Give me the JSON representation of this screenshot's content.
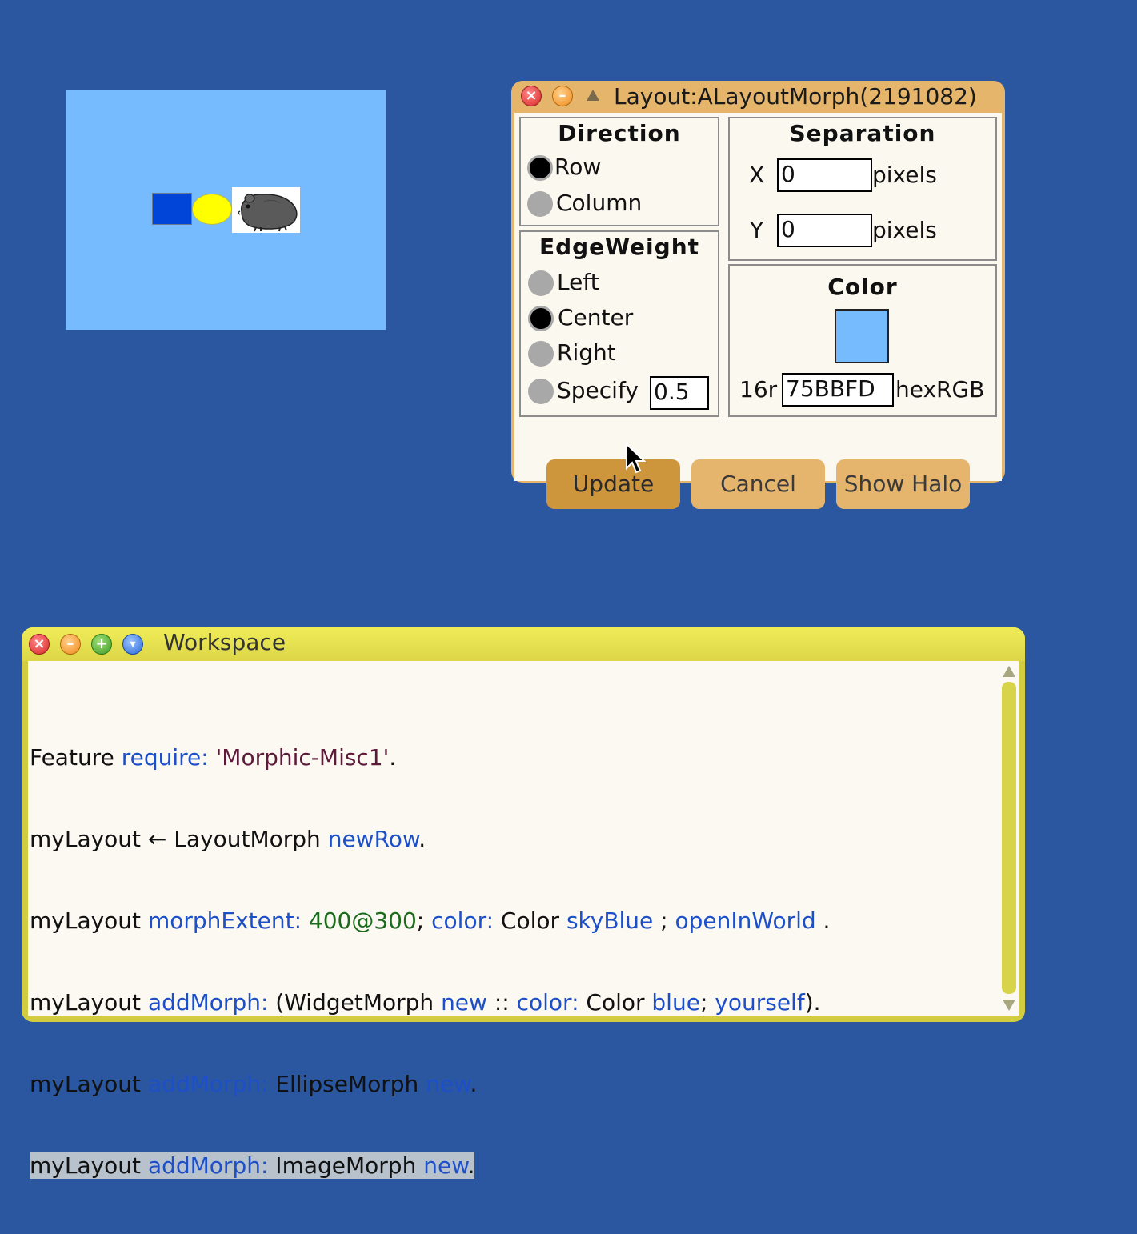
{
  "layout_morph": {
    "color": "#75BBFD",
    "children": [
      "blue-widget",
      "yellow-ellipse",
      "hamster-image"
    ]
  },
  "layout_dialog": {
    "title": "Layout:ALayoutMorph(2191082)",
    "direction": {
      "title": "Direction",
      "options": [
        {
          "label": "Row",
          "selected": true
        },
        {
          "label": "Column",
          "selected": false
        }
      ]
    },
    "edge_weight": {
      "title": "EdgeWeight",
      "options": [
        {
          "label": "Left",
          "selected": false
        },
        {
          "label": "Center",
          "selected": true
        },
        {
          "label": "Right",
          "selected": false
        },
        {
          "label": "Specify",
          "selected": false
        }
      ],
      "specify_value": "0.5"
    },
    "separation": {
      "title": "Separation",
      "x_label": "X",
      "x_value": "0",
      "y_label": "Y",
      "y_value": "0",
      "unit": "pixels"
    },
    "color": {
      "title": "Color",
      "swatch": "#75BBFD",
      "prefix": "16r",
      "value": "75BBFD",
      "suffix": "hexRGB"
    },
    "buttons": {
      "update": "Update",
      "cancel": "Cancel",
      "show_halo": "Show Halo"
    }
  },
  "workspace": {
    "title": "Workspace"
  }
}
